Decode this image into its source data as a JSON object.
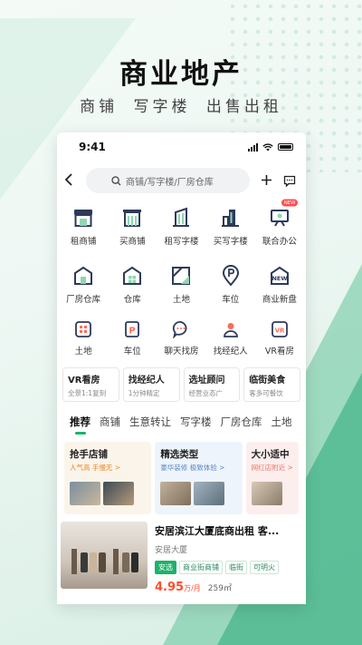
{
  "promo": {
    "title": "商业地产",
    "subtitle": "商铺 写字楼 出售出租"
  },
  "status": {
    "time": "9:41"
  },
  "search": {
    "placeholder": "商铺/写字楼/厂房仓库"
  },
  "grid_row1": [
    {
      "label": "租商铺",
      "icon": "shop-icon"
    },
    {
      "label": "买商铺",
      "icon": "store-icon"
    },
    {
      "label": "租写字楼",
      "icon": "office-building-icon"
    },
    {
      "label": "买写字楼",
      "icon": "buildings-icon"
    },
    {
      "label": "联合办公",
      "icon": "cowork-icon",
      "badge": "NEW"
    }
  ],
  "grid_row2": [
    {
      "label": "厂房仓库",
      "icon": "factory-icon"
    },
    {
      "label": "仓库",
      "icon": "warehouse-icon"
    },
    {
      "label": "土地",
      "icon": "land-icon"
    },
    {
      "label": "车位",
      "icon": "parking-pin-icon"
    },
    {
      "label": "商业新盘",
      "icon": "new-project-icon",
      "icon_text": "NEW"
    }
  ],
  "grid_row3": [
    {
      "label": "土地",
      "icon": "land-small-icon"
    },
    {
      "label": "车位",
      "icon": "parking-small-icon",
      "icon_text": "P"
    },
    {
      "label": "聊天找房",
      "icon": "chat-icon"
    },
    {
      "label": "找经纪人",
      "icon": "agent-icon"
    },
    {
      "label": "VR看房",
      "icon": "vr-icon",
      "icon_text": "VR"
    }
  ],
  "quick_cards": [
    {
      "title": "VR看房",
      "sub": "全景1:1复刻"
    },
    {
      "title": "找经纪人",
      "sub": "1分钟精定"
    },
    {
      "title": "选址顾问",
      "sub": "经营业态广"
    },
    {
      "title": "临街美食",
      "sub": "客多可餐饮"
    }
  ],
  "tabs": [
    "推荐",
    "商铺",
    "生意转让",
    "写字楼",
    "厂房仓库",
    "土地"
  ],
  "promos": [
    {
      "title": "抢手店铺",
      "sub": "人气高 手慢无 >"
    },
    {
      "title": "精选类型",
      "sub": "豪华装修 极致体验 >"
    },
    {
      "title": "大小适中",
      "sub": "网红店附近 >"
    }
  ],
  "listing": {
    "title": "安居滨江大厦底商出租 客...",
    "building": "安居大厦",
    "tags": [
      "安选",
      "商业街商铺",
      "临街",
      "可明火"
    ],
    "price": "4.95",
    "price_unit": "万/月",
    "area": "259㎡"
  },
  "colors": {
    "accent": "#1bb36b",
    "price": "#ff4d2d",
    "icon": "#2d3a5a"
  }
}
